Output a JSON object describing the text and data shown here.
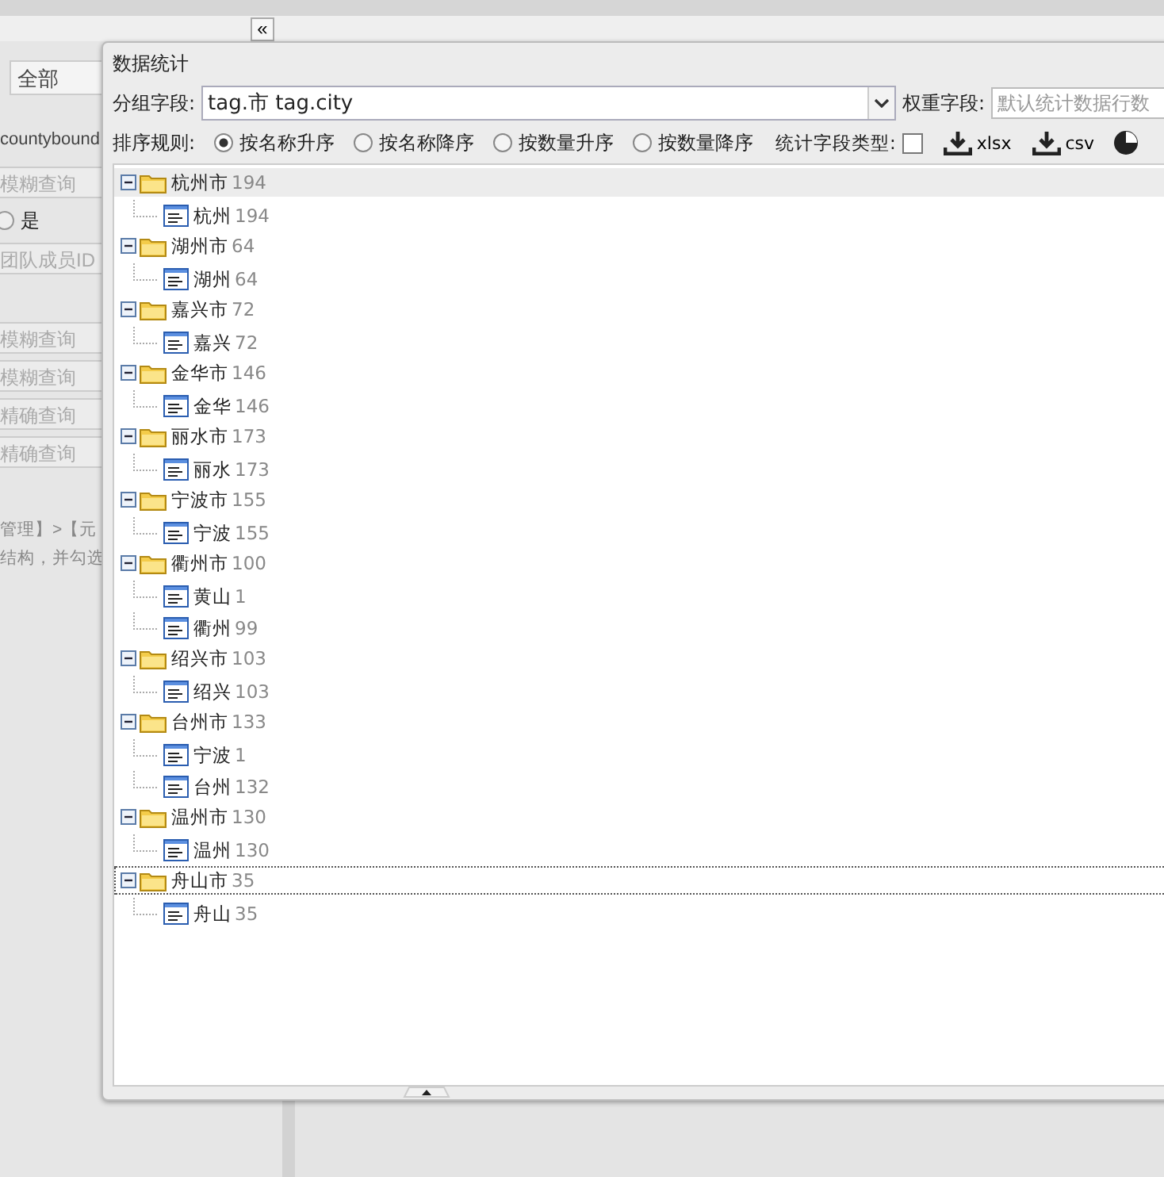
{
  "left_panel": {
    "select_value": "全部",
    "field_label": "countybound",
    "items": [
      {
        "kind": "field",
        "text": "模糊查询"
      },
      {
        "kind": "radio",
        "text": "是",
        "checked": false
      },
      {
        "kind": "field",
        "text": "团队成员ID"
      },
      {
        "kind": "blank"
      },
      {
        "kind": "field",
        "text": "模糊查询"
      },
      {
        "kind": "field",
        "text": "模糊查询"
      },
      {
        "kind": "field",
        "text": "精确查询"
      },
      {
        "kind": "field",
        "text": "精确查询"
      }
    ],
    "note_lines": [
      "管理】>【元",
      "结构，并勾选"
    ]
  },
  "collapse_button": "«",
  "dialog": {
    "title": "数据统计",
    "group_field": {
      "label": "分组字段:",
      "value": "tag.市 tag.city"
    },
    "weight_field": {
      "label": "权重字段:",
      "placeholder": "默认统计数据行数"
    },
    "sort": {
      "label": "排序规则:",
      "options": [
        {
          "label": "按名称升序",
          "selected": true
        },
        {
          "label": "按名称降序",
          "selected": false
        },
        {
          "label": "按数量升序",
          "selected": false
        },
        {
          "label": "按数量降序",
          "selected": false
        }
      ]
    },
    "field_type": {
      "label": "统计字段类型:",
      "checked": false
    },
    "exports": [
      {
        "label": "xlsx"
      },
      {
        "label": "csv"
      }
    ],
    "tree": [
      {
        "name": "杭州市",
        "count": "194",
        "selected": true,
        "focused": false,
        "children": [
          {
            "name": "杭州",
            "count": "194"
          }
        ]
      },
      {
        "name": "湖州市",
        "count": "64",
        "selected": false,
        "focused": false,
        "children": [
          {
            "name": "湖州",
            "count": "64"
          }
        ]
      },
      {
        "name": "嘉兴市",
        "count": "72",
        "selected": false,
        "focused": false,
        "children": [
          {
            "name": "嘉兴",
            "count": "72"
          }
        ]
      },
      {
        "name": "金华市",
        "count": "146",
        "selected": false,
        "focused": false,
        "children": [
          {
            "name": "金华",
            "count": "146"
          }
        ]
      },
      {
        "name": "丽水市",
        "count": "173",
        "selected": false,
        "focused": false,
        "children": [
          {
            "name": "丽水",
            "count": "173"
          }
        ]
      },
      {
        "name": "宁波市",
        "count": "155",
        "selected": false,
        "focused": false,
        "children": [
          {
            "name": "宁波",
            "count": "155"
          }
        ]
      },
      {
        "name": "衢州市",
        "count": "100",
        "selected": false,
        "focused": false,
        "children": [
          {
            "name": "黄山",
            "count": "1"
          },
          {
            "name": "衢州",
            "count": "99"
          }
        ]
      },
      {
        "name": "绍兴市",
        "count": "103",
        "selected": false,
        "focused": false,
        "children": [
          {
            "name": "绍兴",
            "count": "103"
          }
        ]
      },
      {
        "name": "台州市",
        "count": "133",
        "selected": false,
        "focused": false,
        "children": [
          {
            "name": "宁波",
            "count": "1"
          },
          {
            "name": "台州",
            "count": "132"
          }
        ]
      },
      {
        "name": "温州市",
        "count": "130",
        "selected": false,
        "focused": false,
        "children": [
          {
            "name": "温州",
            "count": "130"
          }
        ]
      },
      {
        "name": "舟山市",
        "count": "35",
        "selected": false,
        "focused": true,
        "children": [
          {
            "name": "舟山",
            "count": "35"
          }
        ]
      }
    ]
  }
}
